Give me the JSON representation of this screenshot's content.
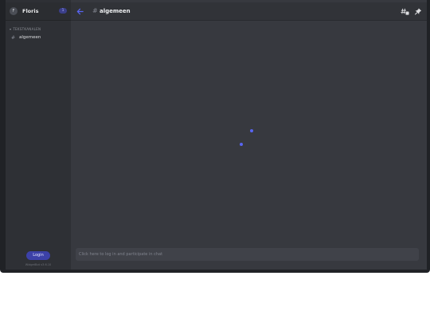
{
  "guild": {
    "avatar_letter": "F",
    "name": "Floris",
    "badge": "1"
  },
  "sidebar": {
    "category": "TEKSTKANALEN",
    "channels": [
      {
        "label": "algemeen"
      }
    ],
    "login_label": "Login",
    "version": "WidgetBot v3.6.10"
  },
  "header": {
    "channel": "algemeen"
  },
  "chat": {
    "placeholder": "Click here to log in and participate in chat"
  },
  "colors": {
    "accent": "#5865f2",
    "login_button": "#3c41a8",
    "background": "#37393f",
    "sidebar": "#2e3035"
  },
  "icons": {
    "back": "arrow-left-icon",
    "hash": "hash-icon",
    "threads": "threads-icon",
    "pin": "pin-icon"
  }
}
